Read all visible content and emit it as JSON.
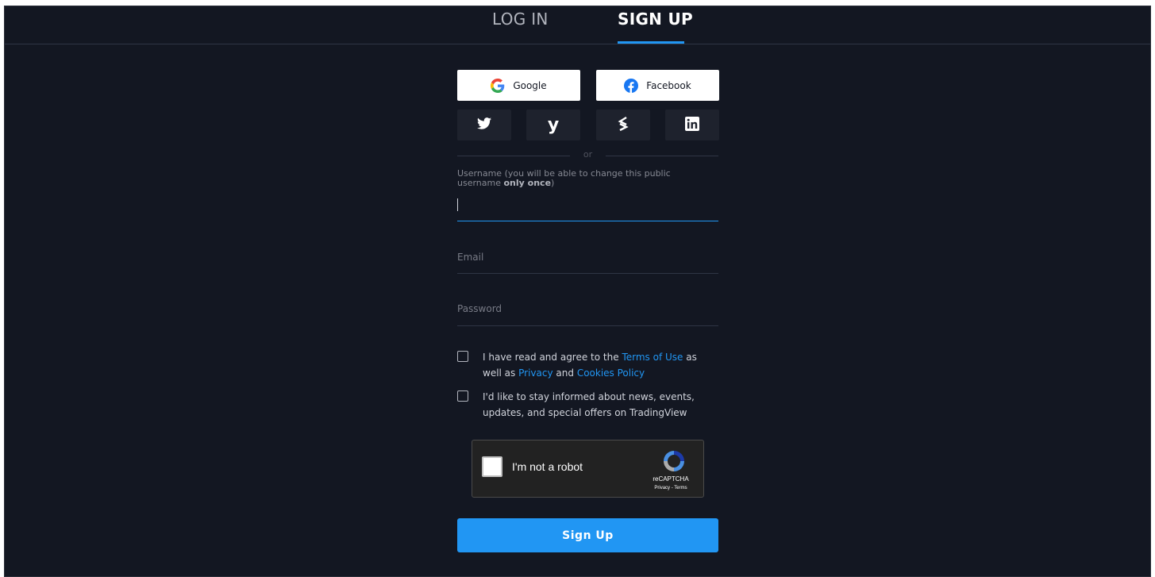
{
  "tabs": {
    "login": "LOG IN",
    "signup": "SIGN UP"
  },
  "social": {
    "google": "Google",
    "facebook": "Facebook",
    "small_icons": [
      "twitter-icon",
      "yahoo-icon",
      "stocktwits-icon",
      "linkedin-icon"
    ]
  },
  "divider": "or",
  "form": {
    "username_label_pre": "Username (you will be able to change this public username",
    "username_label_bold": "only once",
    "username_label_post": ")",
    "username_value": "",
    "email_placeholder": "Email",
    "password_placeholder": "Password"
  },
  "terms": {
    "t1": "I have read and agree to the",
    "terms_link": "Terms of Use",
    "t2": "as well as",
    "privacy_link": "Privacy",
    "t3": "and",
    "cookies_link": "Cookies Policy"
  },
  "newsletter": "I'd like to stay informed about news, events, updates, and special offers on TradingView",
  "recaptcha": {
    "label": "I'm not a robot",
    "brand": "reCAPTCHA",
    "links": "Privacy - Terms"
  },
  "signup_button": "Sign Up",
  "colors": {
    "background": "#131722",
    "accent": "#2196f3",
    "text": "#d1d4dc",
    "muted": "#787b86"
  }
}
